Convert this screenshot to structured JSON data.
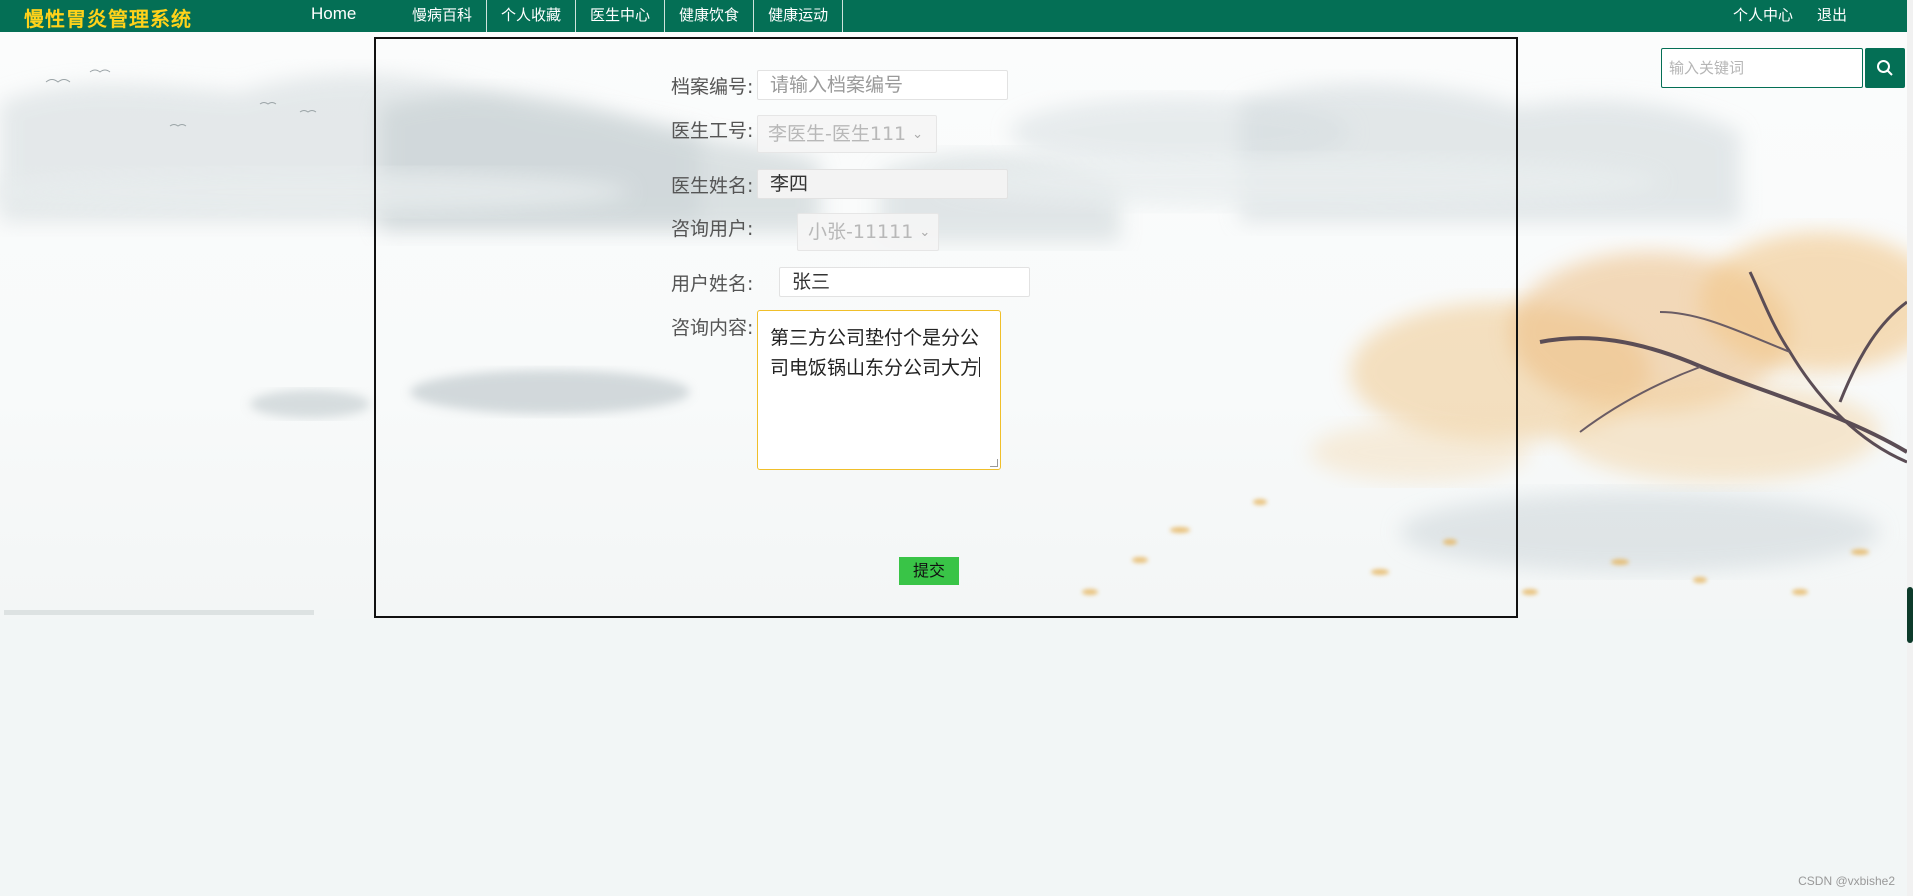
{
  "app": {
    "brand": "慢性胃炎管理系统",
    "home": "Home"
  },
  "nav": {
    "items": [
      "慢病百科",
      "个人收藏",
      "医生中心",
      "健康饮食",
      "健康运动"
    ],
    "right": [
      "个人中心",
      "退出"
    ]
  },
  "search": {
    "placeholder": "输入关键词",
    "icon": "search-icon"
  },
  "form": {
    "archive_no": {
      "label": "档案编号:",
      "value": "",
      "placeholder": "请输入档案编号"
    },
    "doctor_id": {
      "label": "医生工号:",
      "value": "李医生-医生111"
    },
    "doctor_name": {
      "label": "医生姓名:",
      "value": "李四"
    },
    "consult_user": {
      "label": "咨询用户:",
      "value": "小张-11111"
    },
    "user_name": {
      "label": "用户姓名:",
      "value": "张三"
    },
    "consult_content": {
      "label": "咨询内容:",
      "value": "第三方公司垫付个是分公司电饭锅山东分公司大方"
    },
    "submit_label": "提交"
  },
  "footer": {
    "credit": "CSDN @vxbishe2"
  },
  "colors": {
    "nav_bg": "#046f55",
    "brand": "#ffd21a",
    "submit_bg": "#39c447",
    "textarea_focus": "#f0bf2a"
  }
}
